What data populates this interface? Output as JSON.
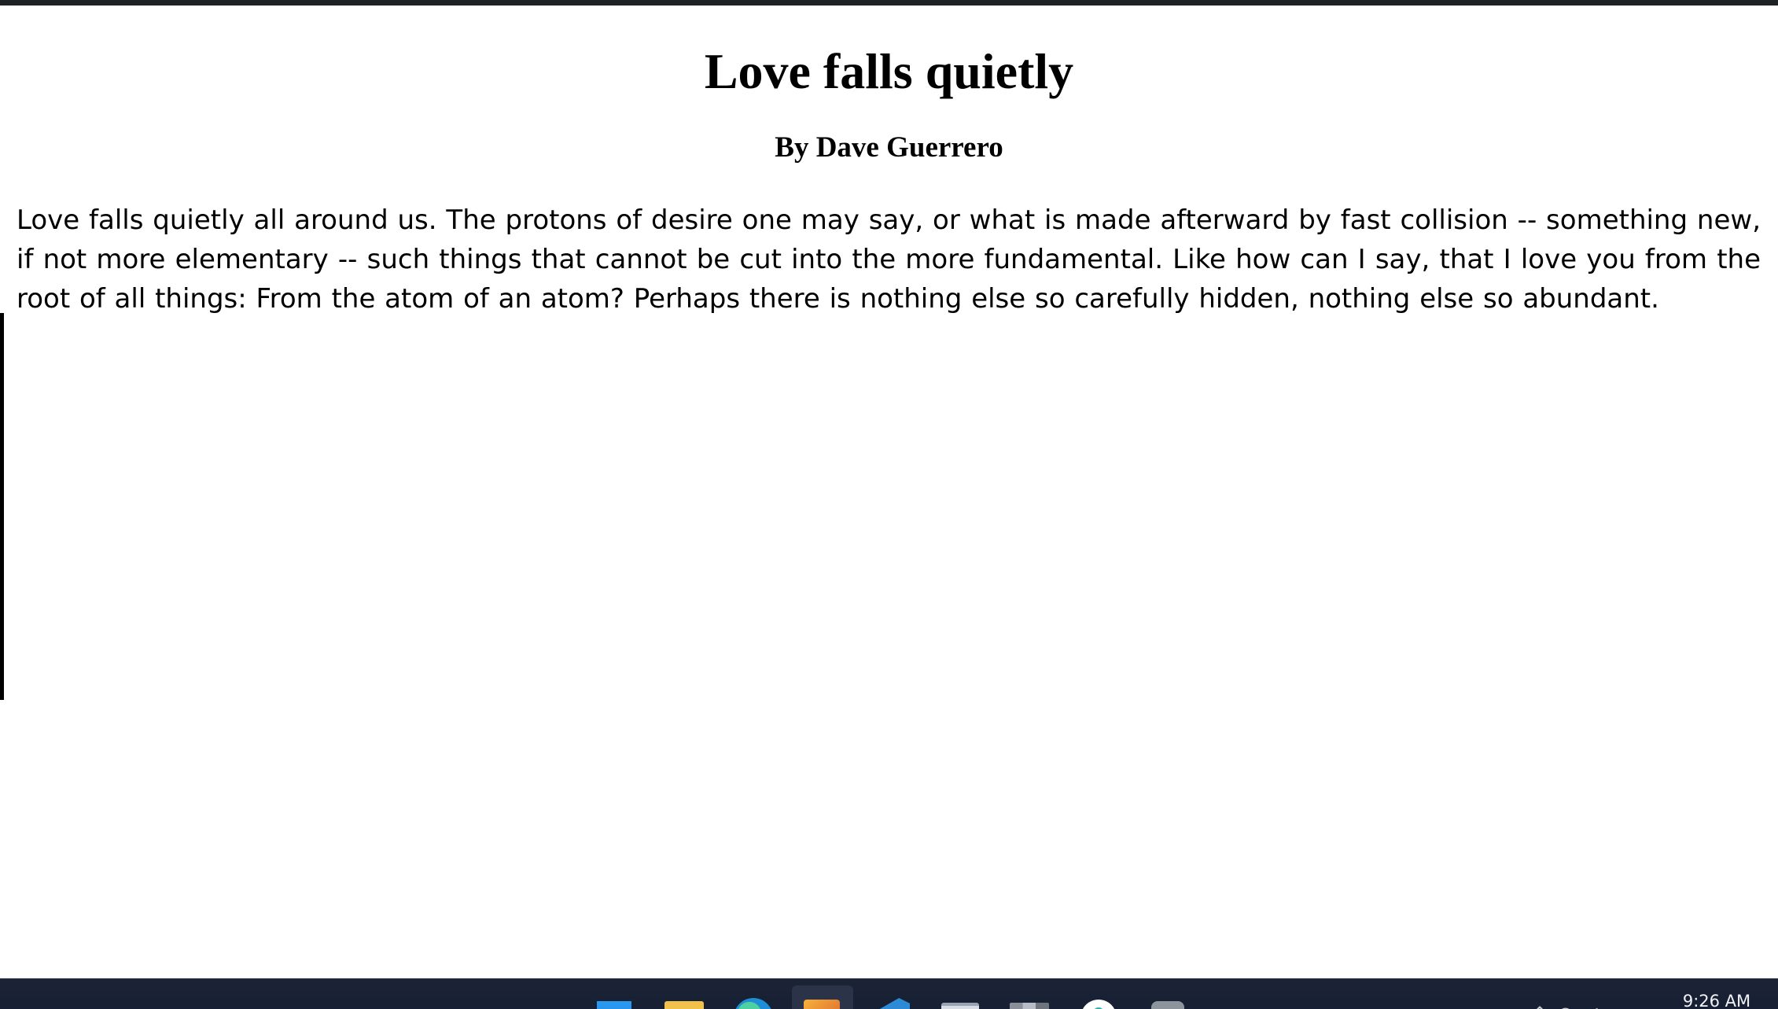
{
  "document": {
    "title": "Love falls quietly",
    "author": "By Dave Guerrero",
    "body": "Love falls quietly all around us. The protons of desire one may say, or what is made afterward by fast collision -- something new, if not more elementary -- such things that cannot be cut into the more fundamental. Like how can I say, that I love you from the root of all things: From the atom of an atom? Perhaps there is nothing else so carefully hidden, nothing else so abundant."
  },
  "taskbar": {
    "icons": [
      {
        "name": "windows-start-icon"
      },
      {
        "name": "file-explorer-icon"
      },
      {
        "name": "edge-browser-icon"
      },
      {
        "name": "active-app-icon"
      },
      {
        "name": "vscode-icon"
      },
      {
        "name": "notepad-icon"
      },
      {
        "name": "tiles-app-icon"
      },
      {
        "name": "chat-app-icon"
      },
      {
        "name": "settings-app-icon"
      }
    ],
    "clock": "9:26 AM"
  },
  "colors": {
    "page_background": "#ffffff",
    "text": "#000000",
    "taskbar": "#1b2333"
  }
}
